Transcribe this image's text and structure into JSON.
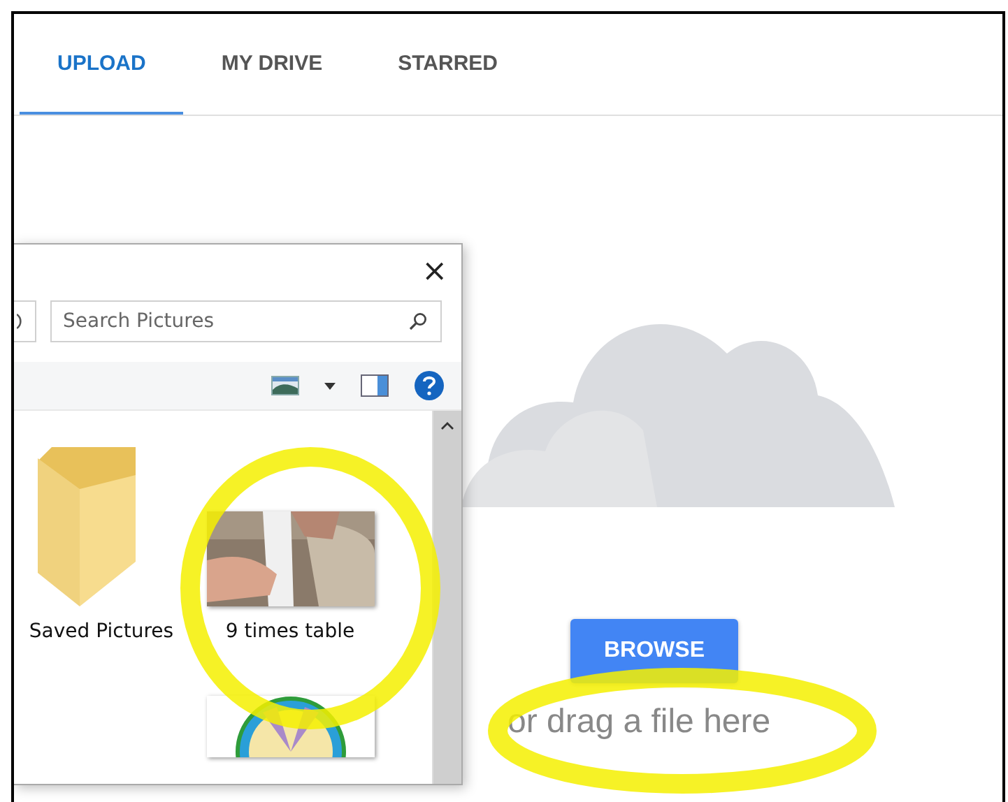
{
  "tabs": [
    {
      "label": "UPLOAD",
      "selected": true
    },
    {
      "label": "MY DRIVE",
      "selected": false
    },
    {
      "label": "STARRED",
      "selected": false
    }
  ],
  "file_dialog": {
    "close": "×",
    "search": {
      "placeholder": "Search Pictures"
    },
    "items": [
      {
        "kind": "folder",
        "name": "Saved Pictures"
      },
      {
        "kind": "picture",
        "name": "9 times table"
      },
      {
        "kind": "picture"
      }
    ]
  },
  "upload": {
    "button": "BROWSE",
    "hint": "or drag a file here"
  }
}
